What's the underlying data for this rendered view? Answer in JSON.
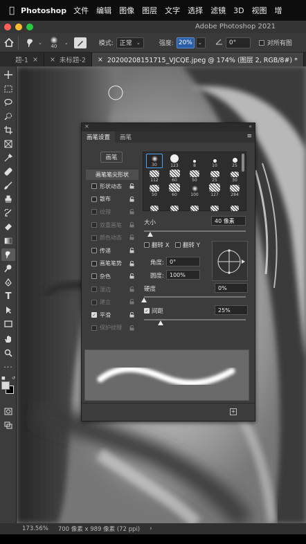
{
  "menubar": {
    "app_name": "Photoshop",
    "items": [
      "文件",
      "编辑",
      "图像",
      "图层",
      "文字",
      "选择",
      "滤镜",
      "3D",
      "视图",
      "增"
    ]
  },
  "window": {
    "title": "Adobe Photoshop 2021"
  },
  "options": {
    "brush_size": "40",
    "mode_label": "模式:",
    "mode_value": "正常",
    "strength_label": "强度:",
    "strength_value": "20%",
    "angle_value": "0°",
    "sample_all_label": "对所有图"
  },
  "tabs": [
    {
      "label": "题-1"
    },
    {
      "label": "未标题-2"
    },
    {
      "label": "20200208151715_VJCQE.jpeg @ 174% (图层 2, RGB/8#) *"
    }
  ],
  "status": {
    "zoom": "173.56%",
    "doc_size": "700 像素 x 989 像素 (72 ppi)"
  },
  "brush_panel": {
    "tab_settings": "画笔设置",
    "tab_brushes": "画笔",
    "preset_button": "画笔",
    "tip_header": "画笔笔尖形状",
    "options": [
      {
        "label": "形状动态",
        "checked": false,
        "enabled": true
      },
      {
        "label": "散布",
        "checked": false,
        "enabled": true
      },
      {
        "label": "纹理",
        "checked": false,
        "enabled": false
      },
      {
        "label": "双重画笔",
        "checked": false,
        "enabled": false
      },
      {
        "label": "颜色动态",
        "checked": false,
        "enabled": false
      },
      {
        "label": "传递",
        "checked": false,
        "enabled": true
      },
      {
        "label": "画笔笔势",
        "checked": false,
        "enabled": true
      },
      {
        "label": "杂色",
        "checked": false,
        "enabled": true
      },
      {
        "label": "湿边",
        "checked": false,
        "enabled": false
      },
      {
        "label": "建立",
        "checked": false,
        "enabled": false
      },
      {
        "label": "平滑",
        "checked": true,
        "enabled": true
      },
      {
        "label": "保护纹理",
        "checked": false,
        "enabled": false
      }
    ],
    "tips": [
      "30",
      "123",
      "8",
      "10",
      "25",
      "112",
      "60",
      "50",
      "25",
      "30",
      "50",
      "60",
      "100",
      "127",
      "284",
      "",
      "",
      "",
      "",
      ""
    ],
    "size_label": "大小",
    "size_value": "40 像素",
    "size_fraction": 0.06,
    "flip_x_label": "翻转 X",
    "flip_y_label": "翻转 Y",
    "angle_label": "角度:",
    "angle_value": "0°",
    "roundness_label": "圆度:",
    "roundness_value": "100%",
    "hardness_label": "硬度",
    "hardness_value": "0%",
    "hardness_fraction": 0,
    "spacing_label": "间距",
    "spacing_value": "25%",
    "spacing_checked": true,
    "spacing_fraction": 0.16
  }
}
